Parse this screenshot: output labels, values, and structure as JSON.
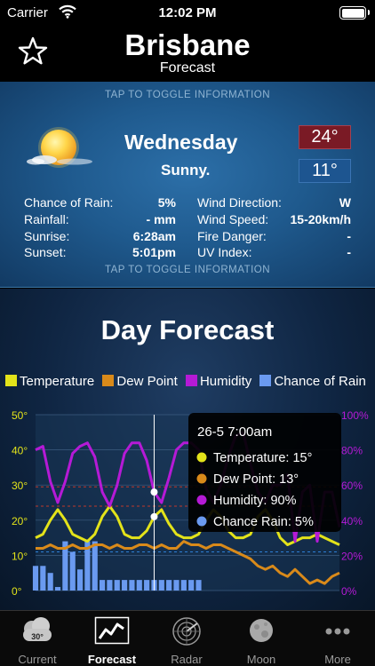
{
  "status_bar": {
    "carrier": "Carrier",
    "time": "12:02 PM"
  },
  "header": {
    "city": "Brisbane",
    "subtitle": "Forecast"
  },
  "info_panel": {
    "toggle_hint_top": "TAP TO TOGGLE INFORMATION",
    "toggle_hint_bottom": "TAP TO TOGGLE INFORMATION",
    "day": "Wednesday",
    "condition": "Sunny.",
    "temp_max": "24°",
    "temp_min": "11°",
    "left_details": [
      {
        "label": "Chance of Rain:",
        "value": "5%"
      },
      {
        "label": "Rainfall:",
        "value": "- mm"
      },
      {
        "label": "Sunrise:",
        "value": "6:28am"
      },
      {
        "label": "Sunset:",
        "value": "5:01pm"
      }
    ],
    "right_details": [
      {
        "label": "Wind Direction:",
        "value": "W"
      },
      {
        "label": "Wind Speed:",
        "value": "15-20km/h"
      },
      {
        "label": "Fire Danger:",
        "value": "-"
      },
      {
        "label": "UV Index:",
        "value": "-"
      }
    ]
  },
  "forecast": {
    "title": "Day Forecast",
    "legend": [
      {
        "label": "Temperature",
        "color": "#e3e31a"
      },
      {
        "label": "Dew Point",
        "color": "#d98a1a"
      },
      {
        "label": "Humidity",
        "color": "#b51ad6"
      },
      {
        "label": "Chance of Rain",
        "color": "#6a9af0"
      }
    ]
  },
  "chart_data": {
    "type": "line",
    "left_axis_ticks": [
      "0°",
      "10°",
      "20°",
      "30°",
      "40°",
      "50°"
    ],
    "right_axis_ticks": [
      "0%",
      "20%",
      "40%",
      "60%",
      "80%",
      "100%"
    ],
    "ylim_left": [
      0,
      50
    ],
    "ylim_right": [
      0,
      100
    ],
    "x_steps": 42,
    "series": [
      {
        "name": "Temperature",
        "color": "#e3e31a",
        "axis": "left",
        "values": [
          15,
          16,
          20,
          23,
          20,
          16,
          15,
          14,
          16,
          21,
          24,
          21,
          16,
          15,
          15,
          17,
          21,
          23,
          19,
          16,
          15,
          15,
          16,
          20,
          23,
          21,
          17,
          15,
          15,
          16,
          21,
          23,
          20,
          15,
          13,
          14,
          15,
          15,
          16,
          15,
          14,
          13
        ]
      },
      {
        "name": "Dew Point",
        "color": "#d98a1a",
        "axis": "left",
        "values": [
          12,
          12,
          13,
          12,
          12,
          13,
          12,
          12,
          13,
          13,
          12,
          13,
          12,
          12,
          13,
          13,
          12,
          13,
          12,
          12,
          14,
          13,
          13,
          12,
          13,
          13,
          12,
          11,
          10,
          9,
          7,
          6,
          7,
          5,
          4,
          6,
          4,
          2,
          3,
          2,
          4,
          5
        ]
      },
      {
        "name": "Humidity",
        "color": "#b51ad6",
        "axis": "left",
        "values": [
          40,
          41,
          31,
          25,
          31,
          39,
          41,
          42,
          38,
          28,
          24,
          30,
          39,
          42,
          42,
          37,
          28,
          25,
          32,
          40,
          42,
          42,
          40,
          29,
          25,
          30,
          38,
          44,
          45,
          36,
          28,
          25,
          30,
          30,
          33,
          14,
          28,
          30,
          14,
          28,
          28,
          18
        ]
      }
    ],
    "rain_bars": [
      14,
      14,
      10,
      2,
      28,
      22,
      12,
      28,
      28,
      6,
      6,
      6,
      6,
      6,
      6,
      6,
      6,
      6,
      6,
      6,
      6,
      6,
      6,
      6,
      6,
      6,
      6,
      6,
      6,
      6,
      6,
      6,
      6,
      6,
      6,
      6,
      6,
      6,
      6,
      6,
      6,
      6
    ],
    "tooltip": {
      "title": "26-5 7:00am",
      "rows": [
        {
          "label": "Temperature: 15°",
          "color": "#e3e31a"
        },
        {
          "label": "Dew Point: 13°",
          "color": "#d98a1a"
        },
        {
          "label": "Humidity: 90%",
          "color": "#b51ad6"
        },
        {
          "label": "Chance Rain: 5%",
          "color": "#6a9af0"
        }
      ]
    }
  },
  "tab_bar": {
    "items": [
      {
        "label": "Current",
        "icon": "cloud-temp-icon",
        "icon_text": "30°"
      },
      {
        "label": "Forecast",
        "icon": "trend-chart-icon"
      },
      {
        "label": "Radar",
        "icon": "radar-icon"
      },
      {
        "label": "Moon",
        "icon": "moon-icon"
      },
      {
        "label": "More",
        "icon": "more-dots-icon"
      }
    ],
    "active": "Forecast"
  }
}
